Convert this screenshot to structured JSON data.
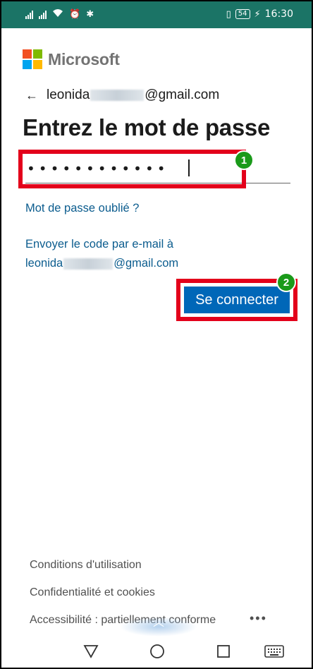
{
  "status_bar": {
    "time": "16:30",
    "battery": "54"
  },
  "brand": {
    "name": "Microsoft",
    "colors": [
      "#f25022",
      "#7fba00",
      "#00a4ef",
      "#ffb900"
    ]
  },
  "identity": {
    "email_prefix": "leonida",
    "email_suffix": "@gmail.com",
    "back_icon": "back-arrow-icon"
  },
  "title": "Entrez le mot de passe",
  "password": {
    "value": "••••••••••••"
  },
  "links": {
    "forgot_password": "Mot de passe oublié ?",
    "send_code_line1": "Envoyer le code par e-mail à",
    "send_code_prefix": "leonida",
    "send_code_suffix": "@gmail.com"
  },
  "signin_button": "Se connecter",
  "annotations": {
    "badge1": "1",
    "badge2": "2",
    "highlight_color": "#e3001b",
    "badge_color": "#1a9a1a"
  },
  "footer": {
    "terms": "Conditions d'utilisation",
    "privacy": "Confidentialité et cookies",
    "accessibility": "Accessibilité : partiellement conforme",
    "more": "•••"
  },
  "accent_color": "#0067b8",
  "statusbar_color": "#1b7466"
}
